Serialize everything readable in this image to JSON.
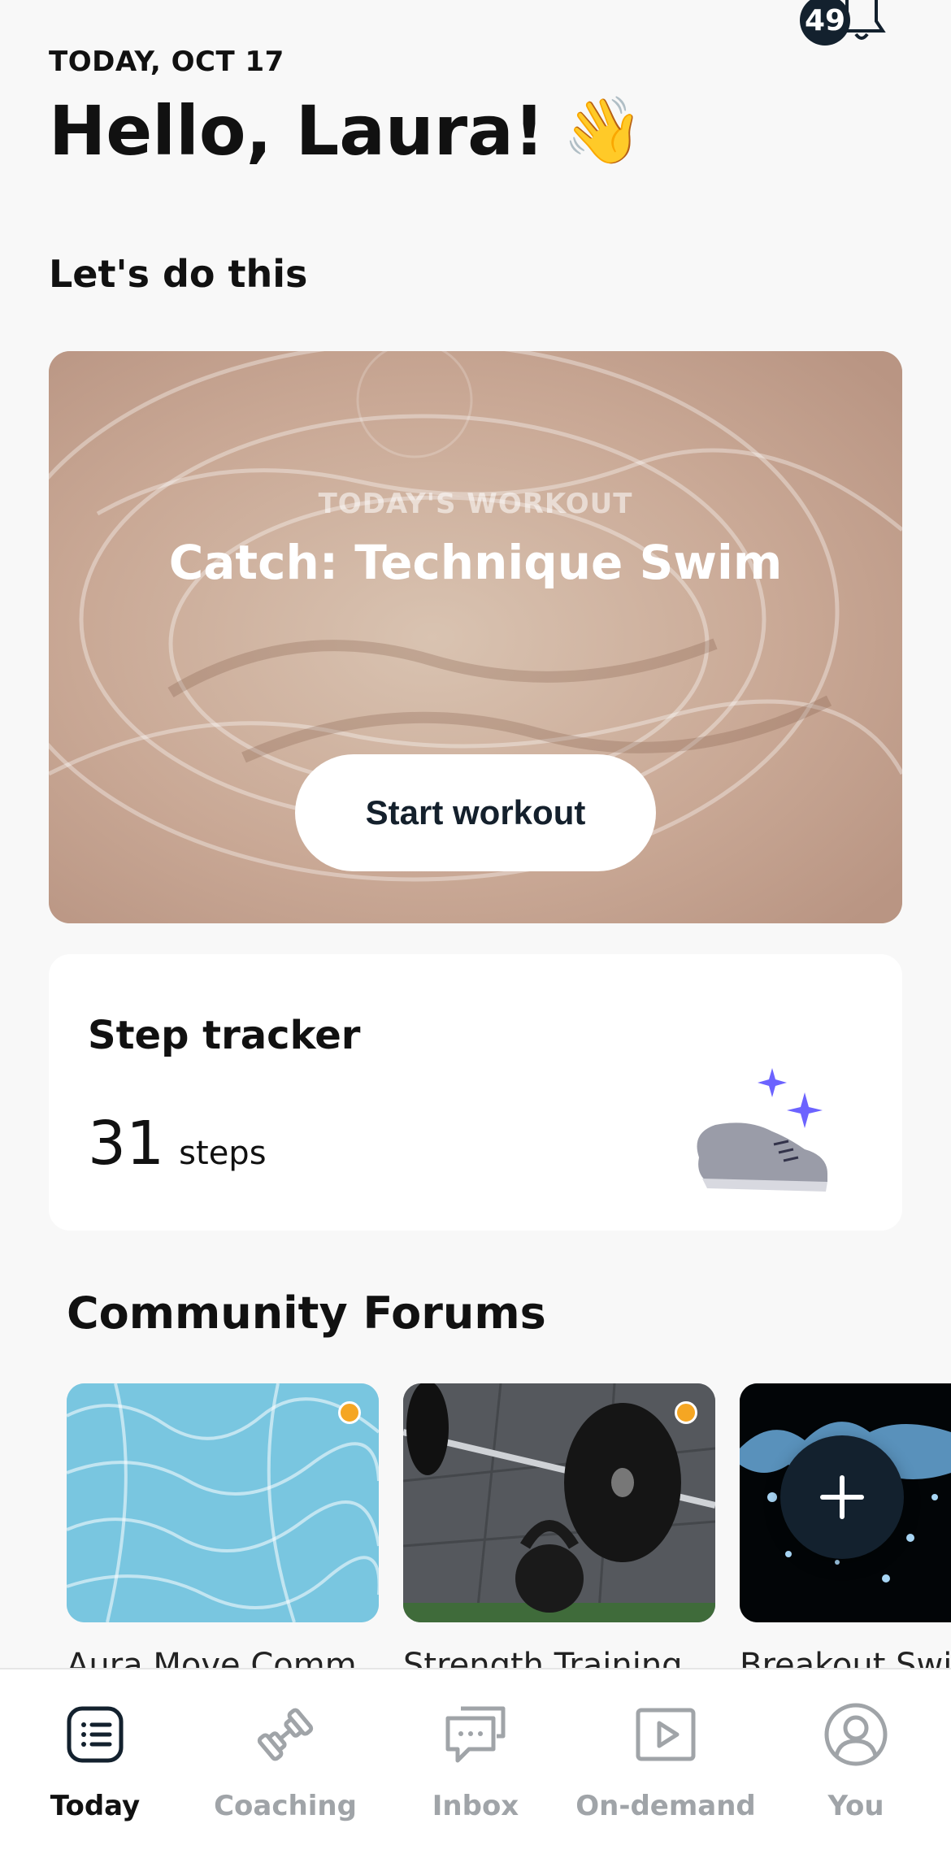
{
  "header": {
    "notification_count": "49",
    "date": "TODAY, OCT 17",
    "greeting": "Hello, Laura!",
    "greeting_emoji": "👋"
  },
  "section_title": "Let's do this",
  "workout": {
    "kicker": "TODAY'S WORKOUT",
    "title": "Catch: Technique Swim",
    "button_label": "Start workout"
  },
  "step_tracker": {
    "title": "Step tracker",
    "count": "31",
    "unit": "steps",
    "icon": "sneaker-icon"
  },
  "community": {
    "title": "Community Forums",
    "forums": [
      {
        "label": "Aura Move Comm",
        "image": "pool-water",
        "unread": true
      },
      {
        "label": "Strength Training",
        "image": "barbell-kettlebell",
        "unread": true
      },
      {
        "label": "Breakout Swi",
        "image": "water-splash",
        "unread": false
      }
    ]
  },
  "nav": {
    "items": [
      {
        "label": "Today",
        "icon": "list-icon",
        "active": true
      },
      {
        "label": "Coaching",
        "icon": "dumbbell-icon",
        "active": false
      },
      {
        "label": "Inbox",
        "icon": "chat-icon",
        "active": false
      },
      {
        "label": "On-demand",
        "icon": "play-icon",
        "active": false
      },
      {
        "label": "You",
        "icon": "profile-icon",
        "active": false
      }
    ]
  },
  "colors": {
    "accent_dark": "#13212e",
    "unread_dot": "#f5a623",
    "sparkle": "#6c63ff"
  }
}
